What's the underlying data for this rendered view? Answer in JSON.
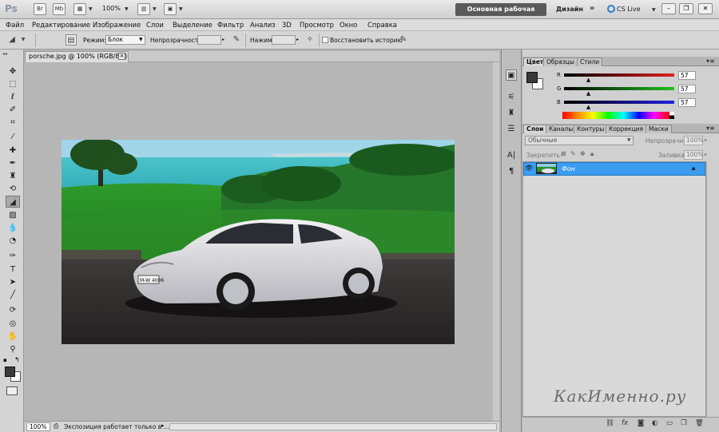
{
  "app": {
    "logo": "Ps",
    "bridge_label": "Br",
    "minibridge_label": "Mb",
    "zoom": "100%",
    "workspace": "Основная рабочая среда",
    "design": "Дизайн",
    "cslive": "CS Live"
  },
  "menu": {
    "items": [
      "Файл",
      "Редактирование",
      "Изображение",
      "Слои",
      "Выделение",
      "Фильтр",
      "Анализ",
      "3D",
      "Просмотр",
      "Окно",
      "Справка"
    ]
  },
  "options": {
    "mode_label": "Режим:",
    "mode_value": "Блок",
    "opacity_label": "Непрозрачность:",
    "opacity_value": "",
    "press_label": "Нажим:",
    "press_value": "",
    "restore_label": "Восстановить историю"
  },
  "document": {
    "tab_title": "porsche.jpg @ 100% (RGB/8#)",
    "close_glyph": "×",
    "status_zoom": "100%",
    "status_text": "Экспозиция работает только в ...",
    "plate": "M-W 4006"
  },
  "color_panel": {
    "tabs": [
      "Цвет",
      "Образцы",
      "Стили"
    ],
    "channels": [
      {
        "name": "R",
        "value": "57",
        "fraction": 0.224,
        "color": "#e02020"
      },
      {
        "name": "G",
        "value": "57",
        "fraction": 0.224,
        "color": "#20c020"
      },
      {
        "name": "B",
        "value": "57",
        "fraction": 0.224,
        "color": "#2020e0"
      }
    ]
  },
  "layers_panel": {
    "tabs": [
      "Слои",
      "Каналы",
      "Контуры",
      "Коррекция",
      "Маски"
    ],
    "blend_mode": "Обычные",
    "opacity_label": "Непрозрачность:",
    "opacity_value": "100%",
    "lock_label": "Закрепить:",
    "fill_label": "Заливка:",
    "fill_value": "100%",
    "layer_name": "Фон",
    "selected_color": "#3b9cf0"
  },
  "watermark": "КакИменно.ру"
}
